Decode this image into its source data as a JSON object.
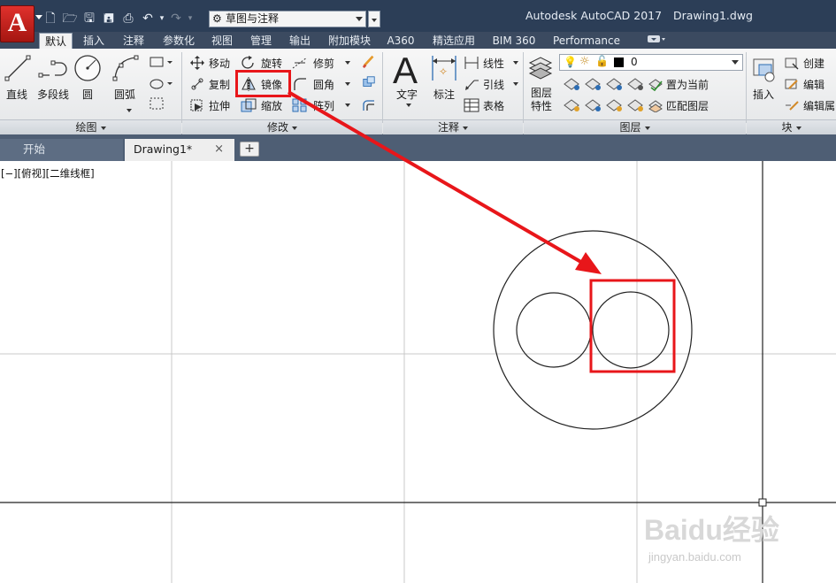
{
  "title_bar": {
    "app_title": "Autodesk AutoCAD 2017",
    "document_title": "Drawing1.dwg",
    "app_button_letter": "A",
    "workspace": "草图与注释"
  },
  "ribbon_tabs": [
    "默认",
    "插入",
    "注释",
    "参数化",
    "视图",
    "管理",
    "输出",
    "附加模块",
    "A360",
    "精选应用",
    "BIM 360",
    "Performance"
  ],
  "ribbon": {
    "draw": {
      "title": "绘图",
      "line": "直线",
      "polyline": "多段线",
      "circle": "圆",
      "arc": "圆弧"
    },
    "modify": {
      "title": "修改",
      "move": "移动",
      "rotate": "旋转",
      "trim": "修剪",
      "copy": "复制",
      "mirror": "镜像",
      "fillet": "圆角",
      "stretch": "拉伸",
      "scale": "缩放",
      "array": "阵列"
    },
    "annotation": {
      "title": "注释",
      "text": "文字",
      "dimension": "标注",
      "linear": "线性",
      "leader": "引线",
      "table": "表格"
    },
    "layers": {
      "title": "图层",
      "layer_properties_line1": "图层",
      "layer_properties_line2": "特性",
      "current_layer": "0",
      "set_current": "置为当前",
      "match_layer": "匹配图层"
    },
    "block": {
      "title": "块",
      "insert": "插入",
      "create": "创建",
      "edit": "编辑",
      "edit_attributes": "编辑属"
    }
  },
  "file_tabs": {
    "start": "开始",
    "drawing": "Drawing1*",
    "close_glyph": "×",
    "new_glyph": "+"
  },
  "viewport": {
    "controls": "[−][俯视][二维线框]"
  },
  "watermark": {
    "logo": "Baidu经验",
    "url": "jingyan.baidu.com"
  },
  "colors": {
    "title_bar": "#2c3e57",
    "ribbon_tabs_bg": "#3b4a60",
    "file_tabs_bg": "#4e5e74",
    "highlight_red": "#e8161a"
  }
}
